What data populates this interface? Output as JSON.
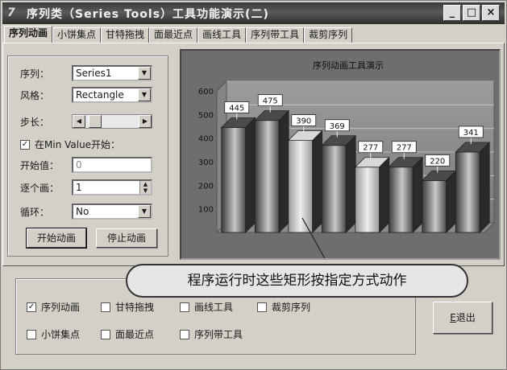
{
  "window": {
    "title": "序列类（Series Tools）工具功能演示(二)",
    "app_icon": "7"
  },
  "titlebar_buttons": [
    "_",
    "□",
    "×"
  ],
  "tabs": [
    "序列动画",
    "小饼集点",
    "甘特拖拽",
    "面最近点",
    "画线工具",
    "序列带工具",
    "裁剪序列"
  ],
  "active_tab": 0,
  "settings": {
    "series_label": "序列：",
    "series_value": "Series1",
    "style_label": "风格：",
    "style_value": "Rectangle",
    "step_label": "步长：",
    "start_from_min_label": "在Min Value开始：",
    "start_from_min_checked": true,
    "start_value_label": "开始值：",
    "start_value": "0",
    "each_label": "逐个画：",
    "each_value": "1",
    "loop_label": "循环：",
    "loop_value": "No",
    "start_button": "开始动画",
    "stop_button": "停止动画"
  },
  "chart_data": {
    "type": "bar",
    "title": "序列动画工具演示",
    "values": [
      445,
      475,
      390,
      369,
      277,
      277,
      220,
      341
    ],
    "ylim": [
      0,
      600
    ],
    "yticks": [
      100,
      200,
      300,
      400,
      500,
      600
    ],
    "grid": true,
    "legend": "none"
  },
  "callout": "程序运行时这些矩形按指定方式动作",
  "options": [
    {
      "label": "序列动画",
      "checked": true
    },
    {
      "label": "甘特拖拽",
      "checked": false
    },
    {
      "label": "画线工具",
      "checked": false
    },
    {
      "label": "裁剪序列",
      "checked": false
    },
    {
      "label": "小饼集点",
      "checked": false
    },
    {
      "label": "面最近点",
      "checked": false
    },
    {
      "label": "序列带工具",
      "checked": false
    }
  ],
  "exit_button": {
    "prefix": "",
    "hotkey": "E",
    "rest": "退出"
  },
  "colors": {
    "bar_light": "#e0e0e0",
    "bar_dark": "#3a3a3a",
    "chart_bg": "#6e6e6e"
  }
}
